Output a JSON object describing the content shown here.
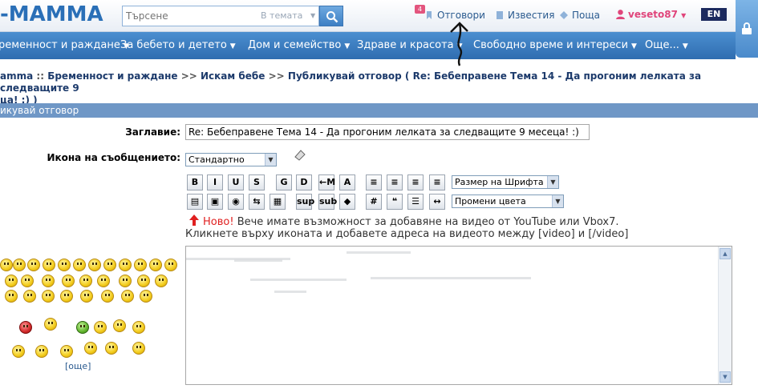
{
  "header": {
    "logo": "-MAMMA",
    "search": {
      "placeholder": "Търсене",
      "scope": "В темата"
    },
    "links": {
      "replies": "Отговори",
      "replies_badge": "4",
      "news": "Известия",
      "mail": "Поща"
    },
    "user": "veseto87",
    "language": "EN"
  },
  "nav": {
    "items": [
      "ременност и раждане",
      "За бебето и детето",
      "Дом и семейство",
      "Здраве и красота",
      "Свободно време и интереси",
      "Още..."
    ]
  },
  "breadcrumb": {
    "line1_parts": [
      "amma",
      "::",
      "Бременност и раждане",
      ">>",
      "Искам бебе",
      ">>",
      "Публикувай отговор",
      "( Re: Бебеправене Тема 14 - Да прогоним лелката за следващите 9"
    ],
    "line2": "ца! :) )"
  },
  "section_title": "икувай отговор",
  "form": {
    "title_label": "Заглавие:",
    "title_value": "Re: Бебеправене Тема 14 - Да прогоним лелката за следващите 9 месеца! :)",
    "icon_label": "Икона на съобщението:",
    "icon_value": "Стандартно",
    "font_size_select": "Размер на Шрифта",
    "color_select": "Промени цвета",
    "toolbar_row1": [
      "B",
      "I",
      "U",
      "S",
      "G",
      "D",
      "←M",
      "A",
      "≡",
      "≡",
      "≡",
      "≡"
    ],
    "toolbar_row2": [
      "▤",
      "▣",
      "◉",
      "⇆",
      "▦",
      "sup",
      "sub",
      "◆",
      "#",
      "❝",
      "☰",
      "↔"
    ],
    "notice_new": "Ново!",
    "notice_text": " Вече имате възможност за добавяне на видео от YouTube или Vbox7.",
    "notice_line2": "Кликнете върху иконата и добавете адреса на видеото между [video] и [/video]",
    "more_smilies": "[още]"
  },
  "colors": {
    "nav_bg": "#3a7cc0",
    "section_bar": "#6f97c6",
    "accent_pink": "#e0457b",
    "link_blue": "#2a5a8f"
  }
}
